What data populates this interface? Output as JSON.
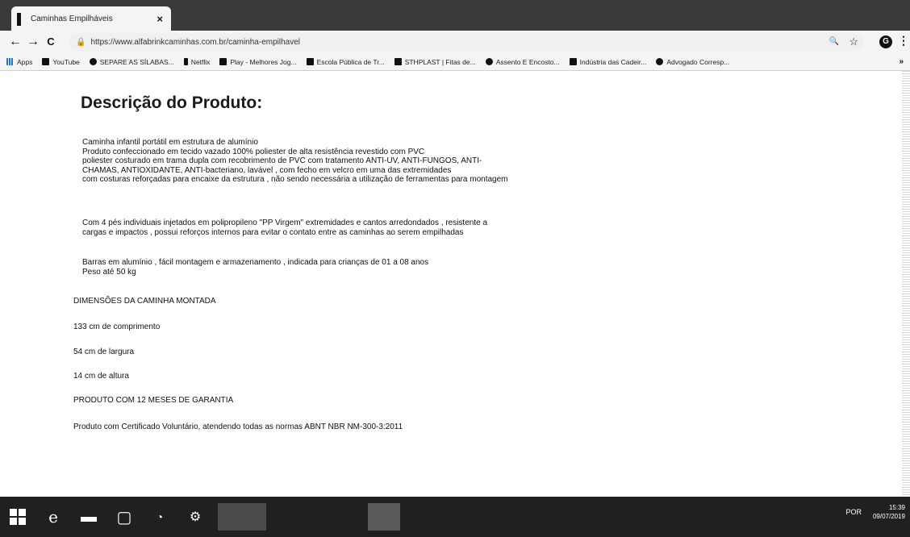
{
  "tab": {
    "title": "Caminhas Empilháveis",
    "close": "×"
  },
  "toolbar": {
    "back": "←",
    "forward": "→",
    "reload": "C",
    "url": "https://www.alfabrinkcaminhas.com.br/caminha-empilhavel",
    "search_icon": "🔍",
    "star_icon": "☆",
    "menu": "⋮"
  },
  "bookmarks": [
    {
      "label": "Apps",
      "icon": "apps-icon"
    },
    {
      "label": "YouTube",
      "icon": "youtube-icon"
    },
    {
      "label": "SEPARE AS SÍLABAS...",
      "icon": "circle-icon"
    },
    {
      "label": "Netflix",
      "icon": "netflix-icon"
    },
    {
      "label": "Play - Melhores Jog...",
      "icon": "play-icon"
    },
    {
      "label": "Escola Pública de Tr...",
      "icon": "school-icon"
    },
    {
      "label": "STHPLAST | Fitas de...",
      "icon": "s-icon"
    },
    {
      "label": "Assento E Encosto...",
      "icon": "seat-icon"
    },
    {
      "label": "Indústria das Cadeir...",
      "icon": "chair-icon"
    },
    {
      "label": "Advogado Corresp...",
      "icon": "lawyer-icon"
    }
  ],
  "bookmarks_more": "»",
  "content": {
    "title": "Descrição do Produto:",
    "paragraph1": [
      "Caminha infantil portátil em estrutura de alumínio",
      "Produto confeccionado em tecido vazado 100% poliester de alta resistência revestido com PVC",
      "poliester costurado em trama dupla com recobrimento de PVC com tratamento ANTI-UV, ANTI-FUNGOS, ANTI-",
      "CHAMAS, ANTIOXIDANTE,  ANTI-bacteriano, lavável , com fecho em velcro em uma das extremidades",
      "com costuras reforçadas para encaixe da estrutura , não sendo necessária a utilização de ferramentas para montagem"
    ],
    "paragraph2": [
      "Com 4 pés individuais injetados em polipropileno \"PP Virgem\" extremidades e cantos arredondados , resistente a",
      "cargas e impactos , possui reforços internos para evitar o contato entre as caminhas ao serem empilhadas"
    ],
    "paragraph3": [
      "Barras em alumínio , fácil montagem e armazenamento , indicada para crianças de 01 a 08 anos",
      "Peso até 50 kg"
    ],
    "dimensions_heading": "DIMENSÕES DA CAMINHA MONTADA",
    "length": "133 cm de comprimento",
    "width": "54 cm de largura",
    "height": "14 cm de altura",
    "warranty": "PRODUTO COM 12 MESES DE GARANTIA",
    "certification": "Produto com Certificado Voluntário, atendendo todas as normas ABNT NBR NM-300-3:2011"
  },
  "taskbar": {
    "language": "POR",
    "time": "15:39",
    "date": "09/07/2019"
  }
}
